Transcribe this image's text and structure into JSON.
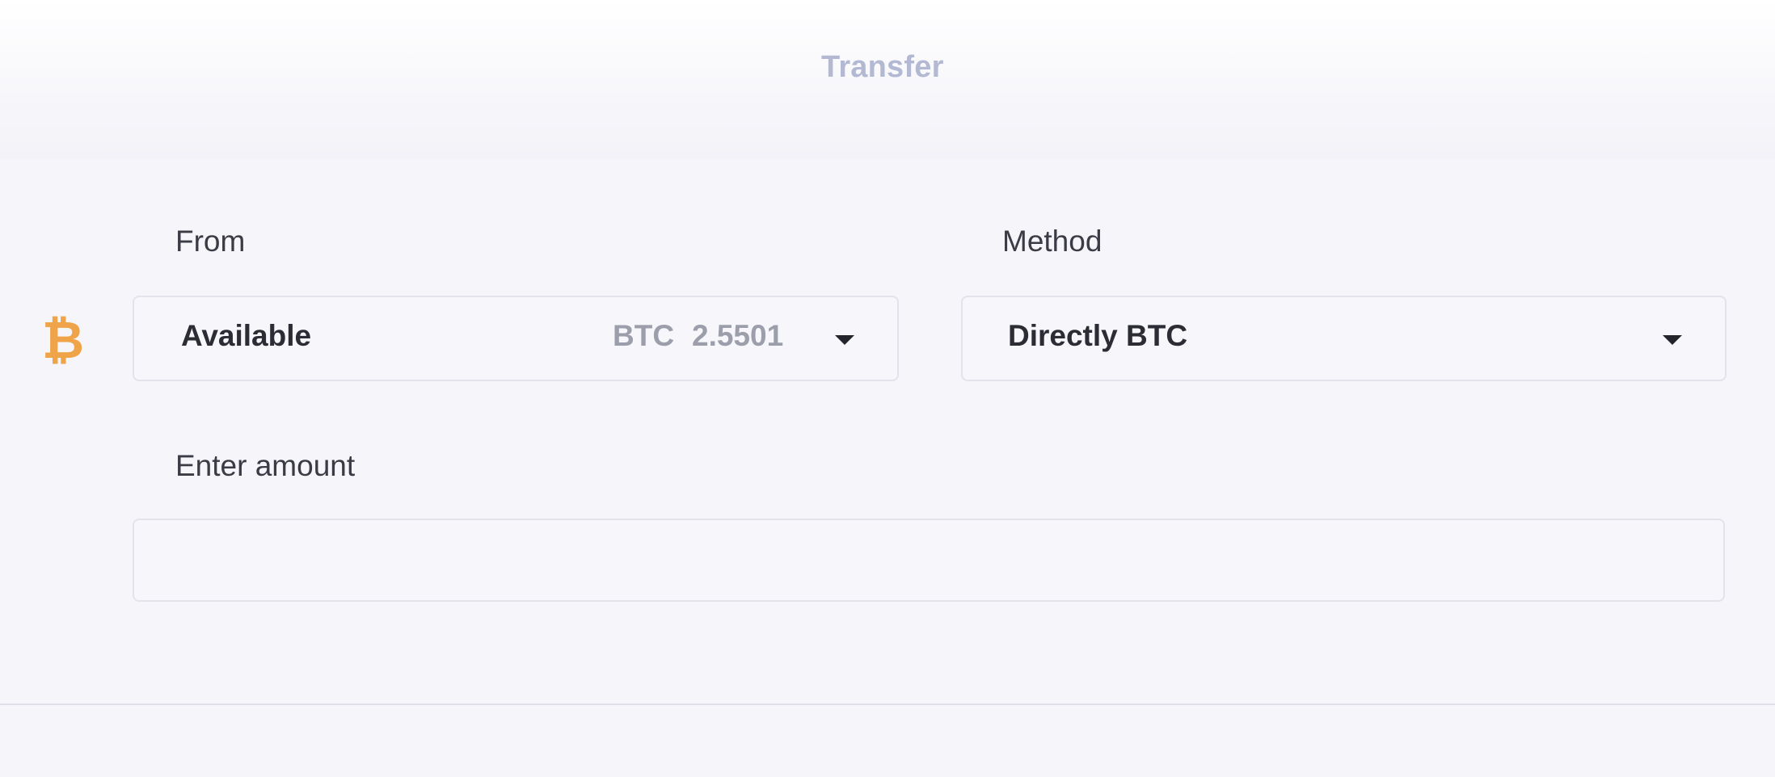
{
  "header": {
    "title": "Transfer"
  },
  "from": {
    "label": "From",
    "selected_label": "Available",
    "currency": "BTC",
    "balance": "2.5501",
    "icon": "bitcoin-icon",
    "icon_color": "#f0a44a"
  },
  "method": {
    "label": "Method",
    "selected_label": "Directly BTC"
  },
  "amount": {
    "label": "Enter amount",
    "value": "",
    "placeholder": ""
  },
  "colors": {
    "header_title": "#b3b9d3",
    "background": "#f5f5fa",
    "border": "#e3e3ec"
  }
}
